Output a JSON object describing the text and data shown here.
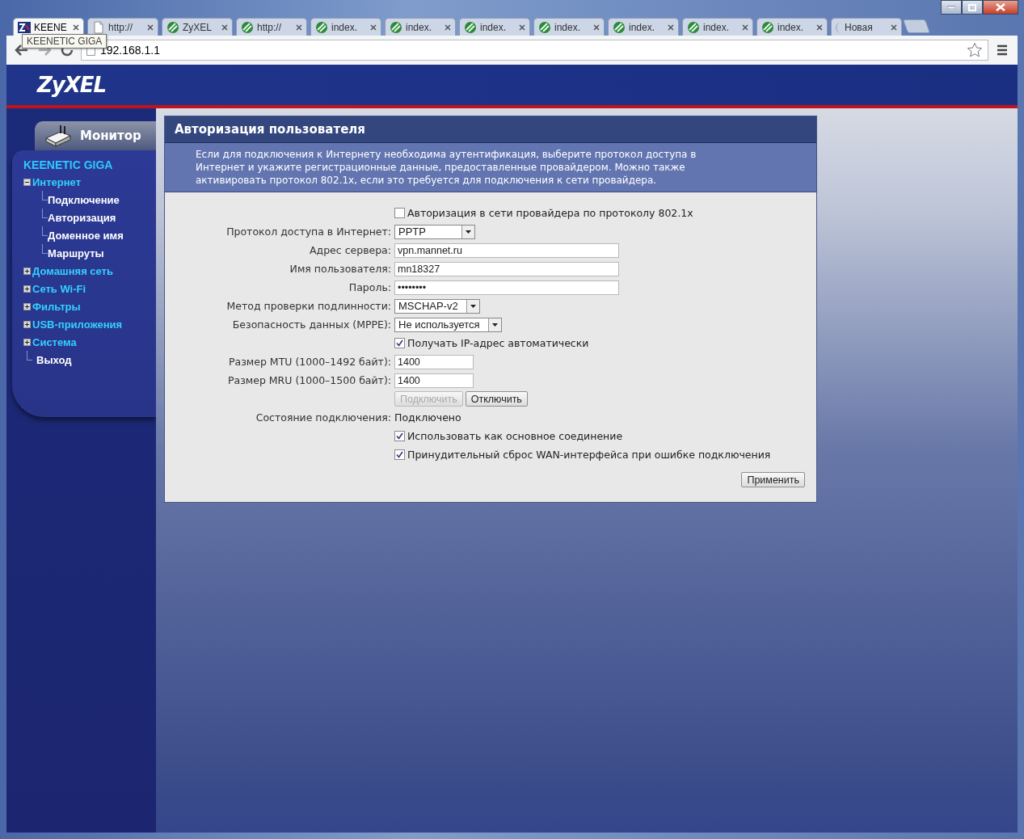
{
  "window": {
    "tabs": [
      {
        "title": "KEENE",
        "selected": true
      },
      {
        "title": "http://",
        "selected": false
      },
      {
        "title": "ZyXEL",
        "selected": false
      },
      {
        "title": "http://",
        "selected": false
      },
      {
        "title": "index.",
        "selected": false
      },
      {
        "title": "index.",
        "selected": false
      },
      {
        "title": "index.",
        "selected": false
      },
      {
        "title": "index.",
        "selected": false
      },
      {
        "title": "index.",
        "selected": false
      },
      {
        "title": "index.",
        "selected": false
      },
      {
        "title": "index.",
        "selected": false
      },
      {
        "title": "Новая",
        "selected": false
      }
    ],
    "tooltip": "KEENETIC GIGA",
    "address": "192.168.1.1"
  },
  "header": {
    "logo": "ZyXEL"
  },
  "sidebar": {
    "tab": "Монитор",
    "device": "KEENETIC GIGA",
    "items": [
      {
        "label": "Интернет",
        "expanded": true,
        "children": [
          {
            "label": "Подключение"
          },
          {
            "label": "Авторизация"
          },
          {
            "label": "Доменное имя"
          },
          {
            "label": "Маршруты"
          }
        ]
      },
      {
        "label": "Домашняя сеть",
        "expanded": false
      },
      {
        "label": "Сеть Wi-Fi",
        "expanded": false
      },
      {
        "label": "Фильтры",
        "expanded": false
      },
      {
        "label": "USB-приложения",
        "expanded": false
      },
      {
        "label": "Система",
        "expanded": false
      },
      {
        "label": "Выход"
      }
    ]
  },
  "panel": {
    "title": "Авторизация пользователя",
    "description": "Если для подключения к Интернету необходима аутентификация, выберите протокол доступа в Интернет и укажите регистрационные данные, предоставленные провайдером. Можно также активировать протокол 802.1x, если это требуется для подключения к сети провайдера.",
    "rows": [
      {
        "kind": "checkbox",
        "text": "Авторизация в сети провайдера по протоколу 802.1x",
        "checked": false
      },
      {
        "kind": "select",
        "label": "Протокол доступа в Интернет:",
        "value": "PPTP"
      },
      {
        "kind": "text",
        "label": "Адрес сервера:",
        "value": "vpn.mannet.ru"
      },
      {
        "kind": "text",
        "label": "Имя пользователя:",
        "value": "mn18327"
      },
      {
        "kind": "text",
        "label": "Пароль:",
        "value": "••••••••"
      },
      {
        "kind": "select",
        "label": "Метод проверки подлинности:",
        "value": "MSCHAP-v2"
      },
      {
        "kind": "select",
        "label": "Безопасность данных (MPPE):",
        "value": "Не используется"
      },
      {
        "kind": "checkbox",
        "text": "Получать IP-адрес автоматически",
        "checked": true
      },
      {
        "kind": "number",
        "label": "Размер MTU (1000–1492 байт):",
        "value": "1400"
      },
      {
        "kind": "number",
        "label": "Размер MRU (1000–1500 байт):",
        "value": "1400"
      },
      {
        "kind": "buttons",
        "buttons": [
          {
            "label": "Подключить",
            "disabled": true
          },
          {
            "label": "Отключить",
            "disabled": false
          }
        ]
      },
      {
        "kind": "status",
        "label": "Состояние подключения:",
        "value": "Подключено"
      },
      {
        "kind": "checkbox",
        "text": "Использовать как основное соединение",
        "checked": true
      },
      {
        "kind": "checkbox",
        "text": "Принудительный сброс WAN-интерфейса при ошибке подключения",
        "checked": true
      }
    ],
    "apply": "Применить"
  }
}
